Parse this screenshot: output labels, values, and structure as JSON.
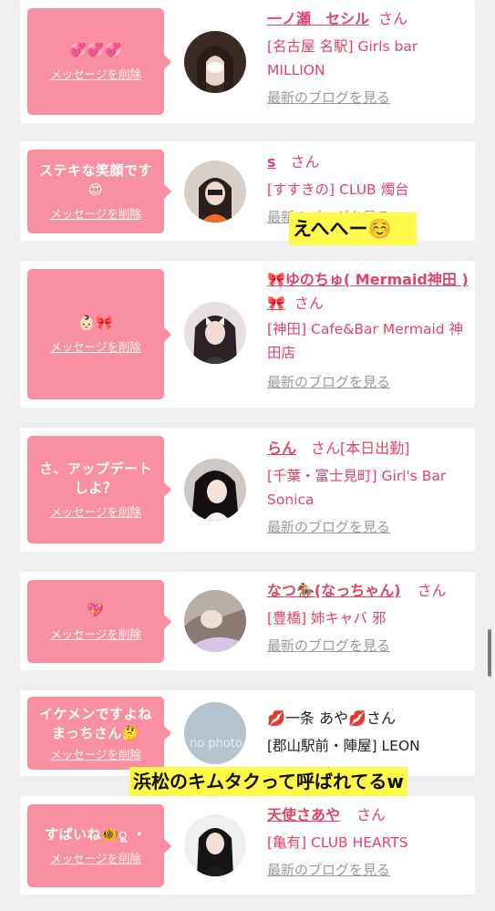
{
  "delete_label": "メッセージを削除",
  "blog_label": "最新のブログを見る",
  "san_label": "さん",
  "entries": [
    {
      "message": "💞💞💞",
      "name": "一ノ瀬　セシル",
      "extra": "",
      "shop": "[名古屋 名駅] Girls bar MILLION"
    },
    {
      "message": "ステキな笑顔です😍",
      "name": "s",
      "extra": "",
      "shop": "[すすきの] CLUB 燭台"
    },
    {
      "message": "👶🏻🎀",
      "name": "🎀ゆのちゅ( Mermaid神田 )🎀",
      "extra": "",
      "shop": "[神田] Cafe&Bar Mermaid 神田店"
    },
    {
      "message": "さ、アップデートしよ？",
      "name": "らん",
      "extra": "[本日出勤]",
      "shop": "[千葉・富士見町] Girl's Bar Sonica"
    },
    {
      "message": "💖",
      "name": "なつ🏇(なっちゃん)",
      "extra": "",
      "shop": "[豊橋] 姉キャバ 邪"
    },
    {
      "message": "イケメンですよね まっちさん🤔",
      "name": "💋一条 あや💋",
      "extra": "",
      "shop": "[郡山駅前・陣屋] LEON",
      "avatar_text": "no photo"
    },
    {
      "message": "すばいね🐠ू ・",
      "name": "天使さあや",
      "extra": "",
      "shop": "[亀有] CLUB HEARTS"
    }
  ],
  "highlights": {
    "ehehe": "えへへー☺️",
    "hamamatsu": "浜松のキムタクって呼ばれてるw"
  }
}
